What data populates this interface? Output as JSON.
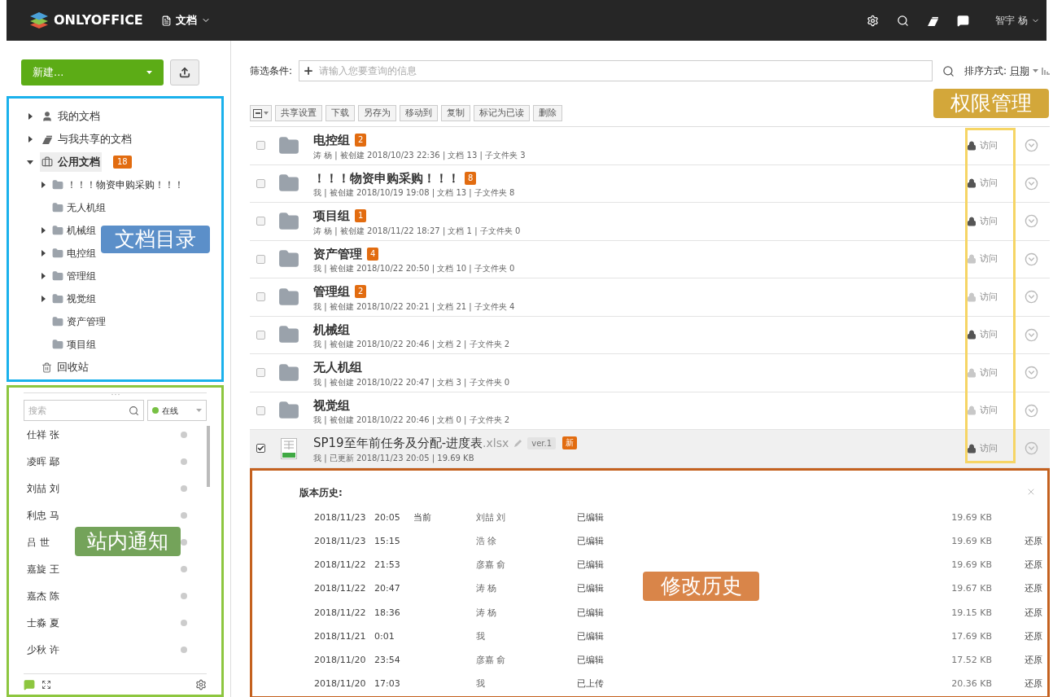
{
  "header": {
    "brand": "ONLYOFFICE",
    "module": "文档",
    "user": "智宇 杨"
  },
  "sidebar": {
    "new_button": "新建...",
    "tree": [
      {
        "kind": "mine",
        "label": "我的文档",
        "expanded": false,
        "selected": false
      },
      {
        "kind": "shared",
        "label": "与我共享的文档",
        "expanded": false,
        "selected": false
      },
      {
        "kind": "common",
        "label": "公用文档",
        "badge": "18",
        "expanded": true,
        "selected": true,
        "children": [
          {
            "label": "！！！物资申购采购！！！",
            "expanded": false,
            "selected": false
          },
          {
            "label": "无人机组",
            "selected": false
          },
          {
            "label": "机械组",
            "expanded": false,
            "selected": false
          },
          {
            "label": "电控组",
            "expanded": false,
            "selected": false
          },
          {
            "label": "管理组",
            "expanded": false,
            "selected": false
          },
          {
            "label": "视觉组",
            "expanded": false,
            "selected": false
          },
          {
            "label": "资产管理",
            "selected": false
          },
          {
            "label": "项目组",
            "selected": false
          }
        ]
      },
      {
        "kind": "trash",
        "label": "回收站",
        "selected": false
      }
    ]
  },
  "chat": {
    "search_placeholder": "搜索",
    "status": "在线",
    "contacts": [
      {
        "name": "仕祥 张",
        "online": false
      },
      {
        "name": "凌晖 鄢",
        "online": false
      },
      {
        "name": "刘喆 刘",
        "online": false
      },
      {
        "name": "利忠 马",
        "online": false
      },
      {
        "name": "吕 世",
        "online": false
      },
      {
        "name": "嘉旋 王",
        "online": false
      },
      {
        "name": "嘉杰 陈",
        "online": false
      },
      {
        "name": "士淼 夏",
        "online": false
      },
      {
        "name": "少秋 许",
        "online": false
      }
    ]
  },
  "filter": {
    "label": "筛选条件:",
    "placeholder": "请输入您要查询的信息",
    "sort_label": "排序方式:",
    "sort_value": "日期"
  },
  "toolbar": [
    "共享设置",
    "下载",
    "另存为",
    "移动到",
    "复制",
    "标记为已读",
    "删除"
  ],
  "rows": [
    {
      "kind": "folder",
      "name": "电控组",
      "badge": "2",
      "meta": "涛 杨 | 被创建 2018/10/23 22:36 | 文档 13 | 子文件夹 3",
      "access": "访问",
      "restricted": true,
      "checked": false,
      "selected": false
    },
    {
      "kind": "folder",
      "name": "！！！物资申购采购！！！",
      "badge": "8",
      "meta": "我 | 被创建 2018/10/19 19:08 | 文档 13 | 子文件夹 8",
      "access": "访问",
      "restricted": true,
      "checked": false,
      "selected": false
    },
    {
      "kind": "folder",
      "name": "项目组",
      "badge": "1",
      "meta": "涛 杨 | 被创建 2018/11/22 18:27 | 文档 1 | 子文件夹 0",
      "access": "访问",
      "restricted": true,
      "checked": false,
      "selected": false
    },
    {
      "kind": "folder",
      "name": "资产管理",
      "badge": "4",
      "meta": "我 | 被创建 2018/10/22 20:50 | 文档 10 | 子文件夹 0",
      "access": "访问",
      "restricted": false,
      "checked": false,
      "selected": false
    },
    {
      "kind": "folder",
      "name": "管理组",
      "badge": "2",
      "meta": "我 | 被创建 2018/10/22 20:21 | 文档 21 | 子文件夹 4",
      "access": "访问",
      "restricted": false,
      "checked": false,
      "selected": false
    },
    {
      "kind": "folder",
      "name": "机械组",
      "meta": "我 | 被创建 2018/10/22 20:46 | 文档 2 | 子文件夹 2",
      "access": "访问",
      "restricted": true,
      "checked": false,
      "selected": false
    },
    {
      "kind": "folder",
      "name": "无人机组",
      "meta": "我 | 被创建 2018/10/22 20:47 | 文档 3 | 子文件夹 0",
      "access": "访问",
      "restricted": false,
      "checked": false,
      "selected": false
    },
    {
      "kind": "folder",
      "name": "视觉组",
      "meta": "我 | 被创建 2018/10/22 20:46 | 文档 0 | 子文件夹 2",
      "access": "访问",
      "restricted": false,
      "checked": false,
      "selected": false
    },
    {
      "kind": "file",
      "name": "SP19至年前任务及分配-进度表",
      "ext": ".xlsx",
      "version": "ver.1",
      "badge": "新",
      "meta": "我 | 已更新 2018/11/23 20:05 | 19.69 KB",
      "access": "访问",
      "restricted": true,
      "checked": true,
      "selected": true
    }
  ],
  "history": {
    "title": "版本历史:",
    "rows": [
      {
        "date": "2018/11/23",
        "time": "20:05",
        "current": "当前",
        "author": "刘喆 刘",
        "action": "已编辑",
        "size": "19.69 KB"
      },
      {
        "date": "2018/11/23",
        "time": "15:15",
        "author": "浩 徐",
        "action": "已编辑",
        "size": "19.69 KB",
        "restore": "还原"
      },
      {
        "date": "2018/11/22",
        "time": "21:53",
        "author": "彦嘉 俞",
        "action": "已编辑",
        "size": "19.69 KB",
        "restore": "还原"
      },
      {
        "date": "2018/11/22",
        "time": "20:47",
        "author": "涛 杨",
        "action": "已编辑",
        "size": "19.67 KB",
        "restore": "还原"
      },
      {
        "date": "2018/11/22",
        "time": "18:36",
        "author": "涛 杨",
        "action": "已编辑",
        "size": "19.15 KB",
        "restore": "还原"
      },
      {
        "date": "2018/11/21",
        "time": "0:01",
        "author": "我",
        "action": "已编辑",
        "size": "17.69 KB",
        "restore": "还原"
      },
      {
        "date": "2018/11/20",
        "time": "23:54",
        "author": "彦嘉 俞",
        "action": "已编辑",
        "size": "17.52 KB",
        "restore": "还原"
      },
      {
        "date": "2018/11/20",
        "time": "17:03",
        "author": "我",
        "action": "已上传",
        "size": "20.36 KB",
        "restore": "还原"
      }
    ]
  },
  "annotations": [
    {
      "kind": "tree",
      "text": "文档目录",
      "color": "#5b8fc9"
    },
    {
      "kind": "chat",
      "text": "站内通知",
      "color": "#74a35a"
    },
    {
      "kind": "permissions",
      "text": "权限管理",
      "color": "#d3a73a"
    },
    {
      "kind": "history",
      "text": "修改历史",
      "color": "#d98549"
    }
  ]
}
